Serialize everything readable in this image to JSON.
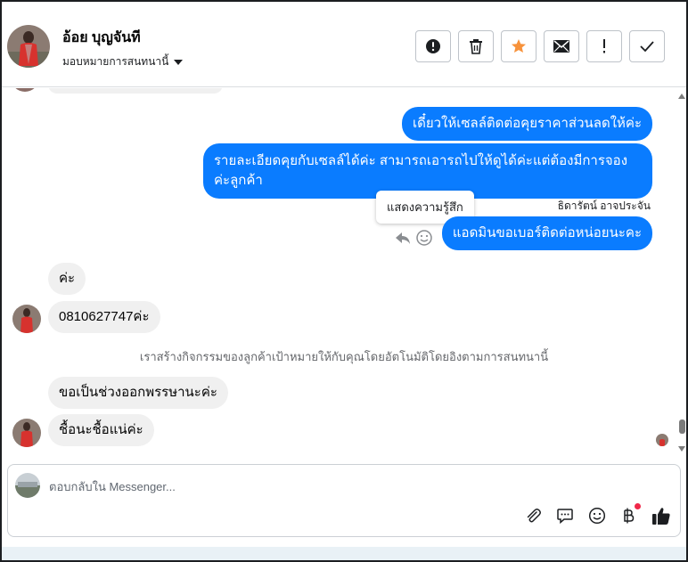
{
  "header": {
    "contact_name": "อ้อย บุญจันที",
    "assign_label": "มอบหมายการสนทนานี้",
    "actions": [
      {
        "name": "spam-button",
        "icon": "exclamation-circle-icon"
      },
      {
        "name": "delete-button",
        "icon": "trash-icon"
      },
      {
        "name": "star-button",
        "icon": "star-icon",
        "color": "#f7923b"
      },
      {
        "name": "mark-unread-button",
        "icon": "envelope-icon"
      },
      {
        "name": "follow-up-button",
        "icon": "exclamation-icon"
      },
      {
        "name": "mark-done-button",
        "icon": "check-icon"
      }
    ]
  },
  "thread": {
    "messages": [
      {
        "direction": "out",
        "text": "เดี๋ยวให้เซลล์ติดต่อคุยราคาส่วนลดให้ค่ะ"
      },
      {
        "direction": "out",
        "text": "รายละเอียดคุยกับเซลล์ได้ค่ะ สามารถเอารถไปให้ดูได้ค่ะแต่ต้องมีการจองค่ะลูกค้า"
      },
      {
        "direction": "out",
        "sender": "ธิดารัตน์ อาจประจัน",
        "text": "แอดมินขอเบอร์ติดต่อหน่อยนะคะ"
      },
      {
        "direction": "in",
        "text": "ค่ะ"
      },
      {
        "direction": "in",
        "text": "0810627747ค่ะ"
      },
      {
        "direction": "in",
        "text": "ขอเป็นช่วงออกพรรษานะค่ะ"
      },
      {
        "direction": "in",
        "text": "ชื้อนะชื้อแน่ค่ะ"
      }
    ],
    "tooltip": "แสดงความรู้สึก",
    "system_note": "เราสร้างกิจกรรมของลูกค้าเป้าหมายให้กับคุณโดยอัตโนมัติโดยอิงตามการสนทนานี้"
  },
  "composer": {
    "placeholder": "ตอบกลับใน Messenger...",
    "tools": [
      "paperclip-icon",
      "saved-reply-icon",
      "emoji-icon",
      "baht-payment-icon",
      "thumbs-up-icon"
    ]
  },
  "colors": {
    "outgoing_bubble": "#0a7cff",
    "incoming_bubble": "#f0f0f0",
    "star": "#f7923b",
    "notification_dot": "#f02849"
  }
}
